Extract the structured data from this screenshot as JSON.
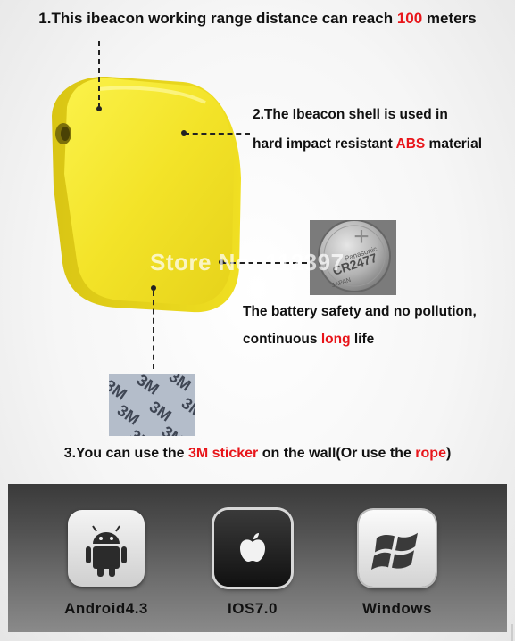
{
  "headline": {
    "before": "1.This ibeacon working range distance can reach ",
    "highlight": "100",
    "after": " meters"
  },
  "shell": {
    "line1": "2.The Ibeacon shell is used in",
    "line2_before": "hard impact resistant ",
    "line2_highlight": "ABS",
    "line2_after": " material"
  },
  "battery": {
    "line1": "The battery safety and no pollution,",
    "line2_before": "continuous ",
    "line2_highlight": "long",
    "line2_after": " life",
    "coin_text": "Panasonic",
    "coin_model": "CR2477",
    "coin_origin": "JAPAN"
  },
  "sticker_note": {
    "before": "3.You can use the ",
    "highlight1": "3M sticker",
    "middle": " on the wall(Or use the ",
    "highlight2": "rope",
    "after": ")"
  },
  "sticker_print": "3M",
  "watermark": "Store No: 112397",
  "platforms": [
    {
      "label": "Android4.3",
      "icon": "android-icon"
    },
    {
      "label": "IOS7.0",
      "icon": "apple-icon"
    },
    {
      "label": "Windows",
      "icon": "windows-icon"
    }
  ],
  "colors": {
    "highlight": "#e8151a",
    "device": "#f2e326",
    "band": "#505050"
  }
}
